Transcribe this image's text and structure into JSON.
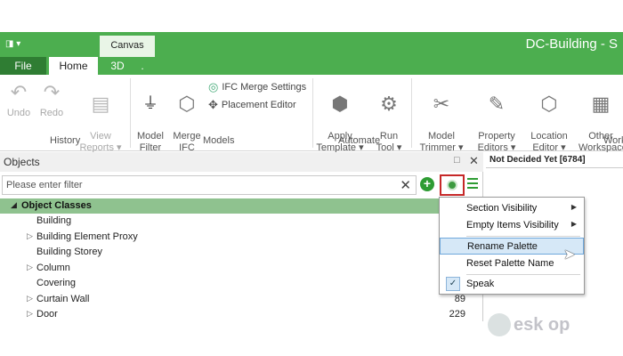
{
  "window": {
    "qa_toolbar": "◨ ▾",
    "canvas_tab": "Canvas",
    "title": "DC-Building - S"
  },
  "ribbon_tabs": [
    {
      "label": "File"
    },
    {
      "label": "Home"
    },
    {
      "label": "3D"
    },
    {
      "label": "."
    }
  ],
  "ribbon": {
    "history": {
      "undo": "Undo",
      "redo": "Redo",
      "view_reports": "View\nReports ▾",
      "group": "History"
    },
    "models": {
      "model_filter": "Model\nFilter",
      "merge_ifc": "Merge\nIFC",
      "ifc_merge_settings": "IFC Merge Settings",
      "placement_editor": "Placement Editor",
      "group": "Models"
    },
    "automate": {
      "apply_template": "Apply\nTemplate ▾",
      "run_tool": "Run\nTool ▾",
      "group": "Automate"
    },
    "other": {
      "model_trimmer": "Model\nTrimmer ▾",
      "property_editors": "Property\nEditors ▾",
      "location_editor": "Location\nEditor ▾",
      "other_workspace": "Other\nWorkspace",
      "group": "Work"
    }
  },
  "objects_panel": {
    "title": "Objects",
    "float_icon": "□",
    "close_icon": "✕",
    "filter_placeholder": "Please enter filter",
    "clear_icon": "✕",
    "add_icon": "+",
    "tree_header": "Object Classes",
    "rows": [
      {
        "name": "Building",
        "expandable": false,
        "count": ""
      },
      {
        "name": "Building Element Proxy",
        "expandable": true,
        "count": ""
      },
      {
        "name": "Building Storey",
        "expandable": false,
        "count": ""
      },
      {
        "name": "Column",
        "expandable": true,
        "count": ""
      },
      {
        "name": "Covering",
        "expandable": false,
        "count": ""
      },
      {
        "name": "Curtain Wall",
        "expandable": true,
        "count": "89"
      },
      {
        "name": "Door",
        "expandable": true,
        "count": "229"
      }
    ]
  },
  "right_panel": {
    "title": "Not Decided Yet [6784]"
  },
  "context_menu": {
    "items": [
      {
        "label": "Section Visibility",
        "submenu": true
      },
      {
        "label": "Empty Items Visibility",
        "submenu": true
      },
      {
        "label": "Rename Palette",
        "highlighted": true
      },
      {
        "label": "Reset Palette Name"
      },
      {
        "label": "Speak",
        "checked": true
      }
    ],
    "submenu_arrow": "▶",
    "check_mark": "✓"
  },
  "watermark": {
    "text": "esk op"
  },
  "colors": {
    "accent_green": "#4cae4f",
    "dark_green": "#2f7d33",
    "highlight_red": "#c62828"
  }
}
